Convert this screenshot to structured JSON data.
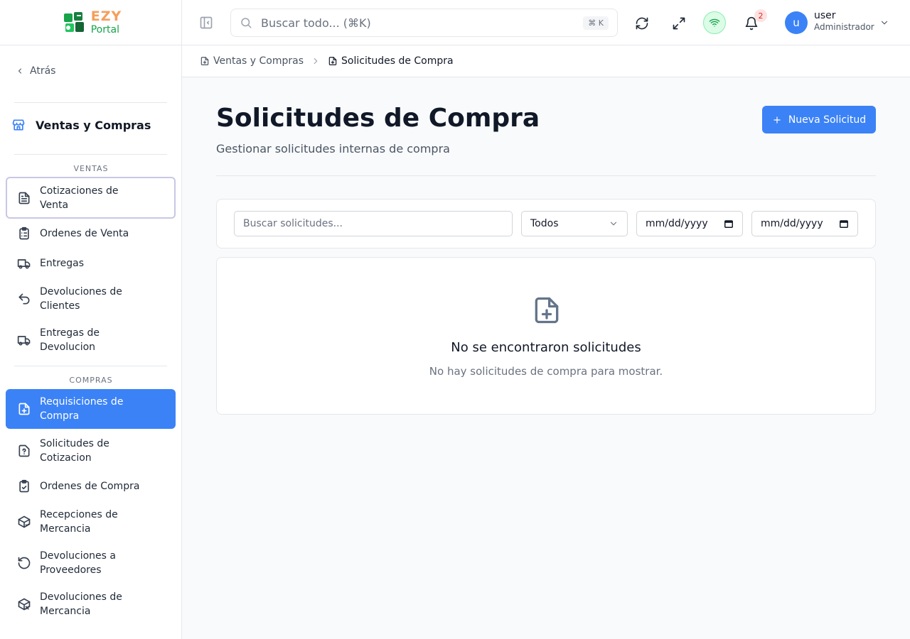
{
  "brand": {
    "top": "EZY",
    "bottom": "Portal"
  },
  "header": {
    "search_placeholder": "Buscar todo... (⌘K)",
    "search_shortcut": "⌘ K",
    "notification_count": "2",
    "user_initial": "u",
    "user_name": "user",
    "user_role": "Administrador"
  },
  "sidebar": {
    "back_label": "Atrás",
    "module_title": "Ventas y Compras",
    "sections": [
      {
        "label": "VENTAS",
        "items": [
          {
            "line1": "Cotizaciones de",
            "line2": "Venta",
            "icon": "file-text-icon"
          },
          {
            "line1": "Ordenes de Venta",
            "line2": "",
            "icon": "clipboard-list-icon"
          },
          {
            "line1": "Entregas",
            "line2": "",
            "icon": "truck-icon"
          },
          {
            "line1": "Devoluciones de",
            "line2": "Clientes",
            "icon": "undo-icon"
          },
          {
            "line1": "Entregas de",
            "line2": "Devolucion",
            "icon": "truck-return-icon"
          }
        ]
      },
      {
        "label": "COMPRAS",
        "items": [
          {
            "line1": "Requisiciones de",
            "line2": "Compra",
            "icon": "file-plus-icon",
            "active": true
          },
          {
            "line1": "Solicitudes de",
            "line2": "Cotizacion",
            "icon": "file-question-icon"
          },
          {
            "line1": "Ordenes de Compra",
            "line2": "",
            "icon": "clipboard-check-icon"
          },
          {
            "line1": "Recepciones de",
            "line2": "Mercancia",
            "icon": "package-check-icon"
          },
          {
            "line1": "Devoluciones a",
            "line2": "Proveedores",
            "icon": "rotate-ccw-icon"
          },
          {
            "line1": "Devoluciones de",
            "line2": "Mercancia",
            "icon": "package-x-icon"
          }
        ]
      }
    ]
  },
  "breadcrumb": {
    "parent": "Ventas y Compras",
    "current": "Solicitudes de Compra"
  },
  "page": {
    "title": "Solicitudes de Compra",
    "subtitle": "Gestionar solicitudes internas de compra",
    "new_button": "Nueva Solicitud"
  },
  "filters": {
    "search_placeholder": "Buscar solicitudes...",
    "status_value": "Todos",
    "date_from_placeholder": "mm/dd/yyyy",
    "date_to_placeholder": "mm/dd/yyyy"
  },
  "empty_state": {
    "title": "No se encontraron solicitudes",
    "description": "No hay solicitudes de compra para mostrar."
  },
  "colors": {
    "accent": "#3b82f6",
    "brand_orange": "#f59e5b",
    "brand_green": "#16a34a",
    "badge_red": "#dc2626"
  }
}
